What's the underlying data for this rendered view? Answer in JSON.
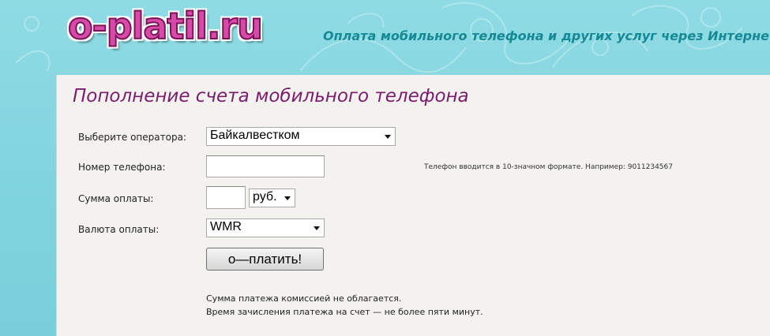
{
  "header": {
    "logo_text": "o-platil.ru",
    "tagline": "Оплата мобильного телефона и других услуг через Интернет"
  },
  "form": {
    "title": "Пополнение счета мобильного телефона",
    "operator_label": "Выберите оператора:",
    "operator_value": "Байкалвестком",
    "phone_label": "Номер телефона:",
    "phone_value": "",
    "phone_hint": "Телефон вводится в 10-значном формате. Например: 9011234567",
    "amount_label": "Сумма оплаты:",
    "amount_value": "",
    "amount_currency_value": "руб.",
    "payment_currency_label": "Валюта оплаты:",
    "payment_currency_value": "WMR",
    "submit_label": "о—платить!",
    "note_line1": "Сумма платежа комиссией не облагается.",
    "note_line2": "Время зачисления платежа на счет — не более пяти минут."
  },
  "colors": {
    "header_bg": "#7fd3de",
    "logo": "#d84aa8",
    "tagline": "#168a94",
    "title": "#7a1d6e",
    "panel_bg": "#f3f2ee"
  }
}
